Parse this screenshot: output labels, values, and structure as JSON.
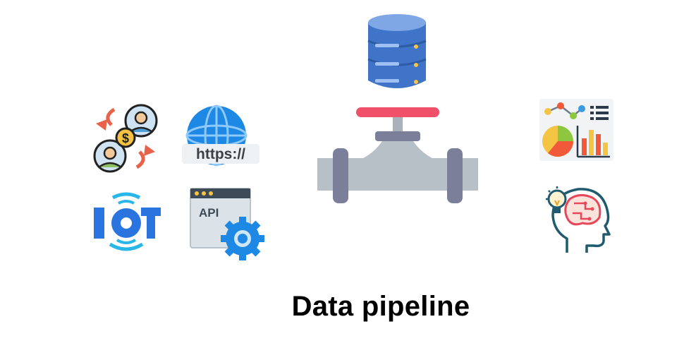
{
  "caption": "Data pipeline",
  "sources": [
    {
      "icon": "money-exchange-icon"
    },
    {
      "icon": "globe-https-icon",
      "label": "https://"
    },
    {
      "icon": "iot-icon",
      "label": "IOT"
    },
    {
      "icon": "api-gear-icon",
      "label": "API"
    }
  ],
  "center": [
    {
      "icon": "database-icon"
    },
    {
      "icon": "pipe-valve-icon"
    }
  ],
  "destinations": [
    {
      "icon": "analytics-chart-icon"
    },
    {
      "icon": "ai-brain-head-icon"
    }
  ],
  "colors": {
    "db_blue": "#4a7fd4",
    "pipe_gray": "#b7bfc7",
    "valve_red": "#f0506a",
    "iot_blue": "#2a74e0",
    "brain_teal": "#1f5a6e"
  }
}
